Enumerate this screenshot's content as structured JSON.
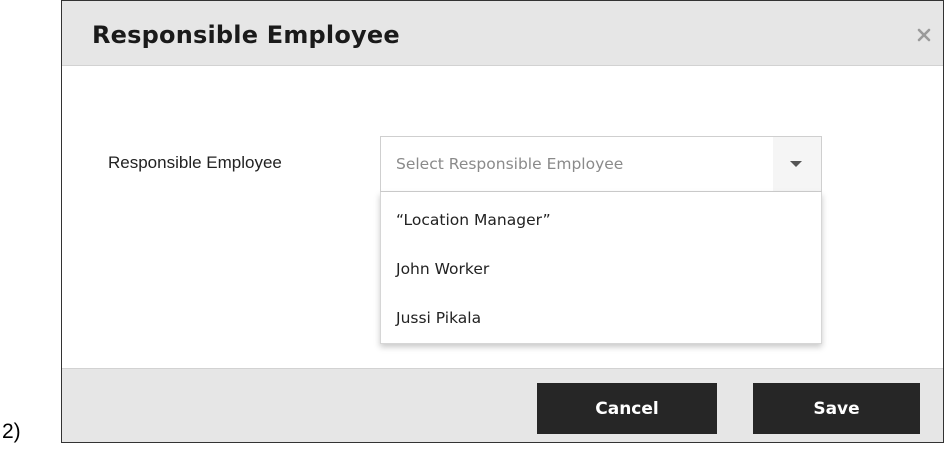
{
  "step_label": "2)",
  "dialog": {
    "title": "Responsible Employee",
    "close_icon": "close-icon"
  },
  "form": {
    "field_label": "Responsible Employee",
    "select": {
      "placeholder": "Select Responsible Employee",
      "arrow_icon": "caret-down-icon",
      "options": [
        "“Location Manager”",
        "John Worker",
        "Jussi Pikala"
      ]
    }
  },
  "footer": {
    "cancel_label": "Cancel",
    "save_label": "Save"
  },
  "colors": {
    "header_bg": "#e6e6e6",
    "button_bg": "#262626",
    "button_text": "#ffffff",
    "placeholder_text": "#8a8a8a"
  }
}
